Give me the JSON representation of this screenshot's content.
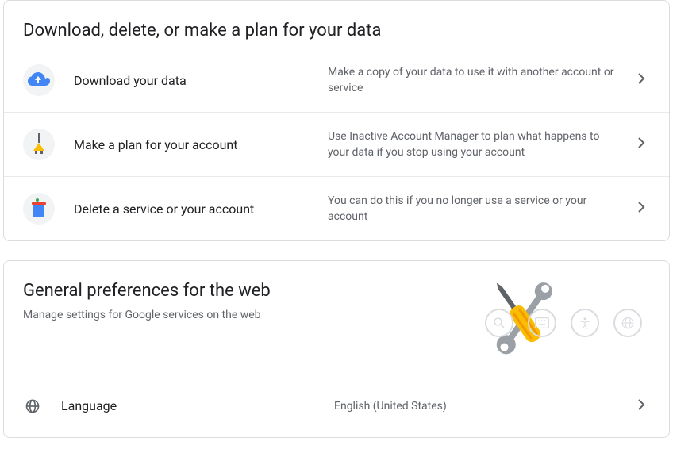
{
  "section1": {
    "title": "Download, delete, or make a plan for your data",
    "rows": [
      {
        "title": "Download your data",
        "desc": "Make a copy of your data to use it with another account or service"
      },
      {
        "title": "Make a plan for your account",
        "desc": "Use Inactive Account Manager to plan what happens to your data if you stop using your account"
      },
      {
        "title": "Delete a service or your account",
        "desc": "You can do this if you no longer use a service or your account"
      }
    ]
  },
  "section2": {
    "title": "General preferences for the web",
    "subtitle": "Manage settings for Google services on the web",
    "language": {
      "label": "Language",
      "value": "English (United States)"
    }
  }
}
